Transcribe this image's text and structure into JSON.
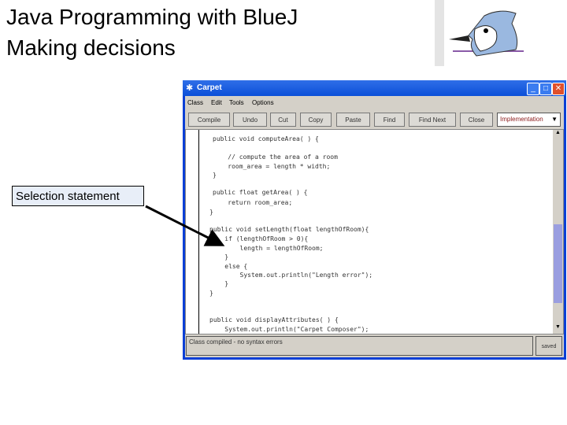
{
  "slide": {
    "title_line1": "Java Programming with BlueJ",
    "title_line2": "Making decisions",
    "callout": "Selection statement"
  },
  "window": {
    "title": "Carpet",
    "menu": [
      "Class",
      "Edit",
      "Tools",
      "Options"
    ],
    "toolbar": [
      "Compile",
      "Undo",
      "Cut",
      "Copy",
      "Paste",
      "Find",
      "Find Next",
      "Close"
    ],
    "view_select": "Implementation",
    "code": [
      "public void computeArea( ) {",
      "    // compute the area of a room",
      "    room_area = length * width;",
      "}",
      "public float getArea( ) {",
      "    return room_area;",
      "}",
      "public void setLength(float lengthOfRoom){",
      "    if (lengthOfRoom > 0){",
      "        length = lengthOfRoom;",
      "    }",
      "    else {",
      "        System.out.println(\"Length error\");",
      "    }",
      "}",
      "public void displayAttributes( ) {",
      "    System.out.println(\"Carpet Composer\");"
    ],
    "status": "Class compiled - no syntax errors",
    "saved": "saved"
  },
  "colors": {
    "titlebar": "#0b4fd8",
    "scroll_thumb": "#9a9ee0",
    "view_select_text": "#8b1a1a"
  }
}
